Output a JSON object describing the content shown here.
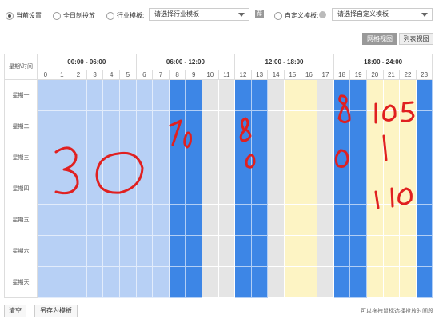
{
  "settings": {
    "radio_current": "当前设置",
    "radio_all_day": "全日制投放",
    "radio_industry": "行业模板:",
    "industry_select": "请选择行业模板",
    "filter_icon_text": "荐",
    "radio_custom": "自定义模板:",
    "custom_select": "请选择自定义模板"
  },
  "view": {
    "grid_label": "网格视图",
    "list_label": "列表视图"
  },
  "schedule": {
    "corner_label": "星期\\时间",
    "periods": [
      "00:00 - 06:00",
      "06:00 - 12:00",
      "12:00 - 18:00",
      "18:00 - 24:00"
    ],
    "hours": [
      "0",
      "1",
      "2",
      "3",
      "4",
      "5",
      "6",
      "7",
      "8",
      "9",
      "10",
      "11",
      "12",
      "13",
      "14",
      "15",
      "16",
      "17",
      "18",
      "19",
      "20",
      "21",
      "22",
      "23"
    ],
    "days": [
      "星期一",
      "星期二",
      "星期三",
      "星期四",
      "星期五",
      "星期六",
      "星期天"
    ],
    "hour_states": [
      "light",
      "light",
      "light",
      "light",
      "light",
      "light",
      "light",
      "light",
      "blue",
      "blue",
      "gray",
      "gray",
      "blue",
      "blue",
      "gray",
      "yellow",
      "yellow",
      "gray",
      "blue",
      "blue",
      "yellow",
      "yellow",
      "yellow",
      "blue"
    ],
    "colors": {
      "light": "#b7d0f5",
      "blue": "#3d86e6",
      "gray": "#e5e5e5",
      "yellow": "#fdf4c4"
    }
  },
  "handwritten_notes": [
    "30",
    "70",
    "80",
    "80",
    "105",
    "1",
    "110"
  ],
  "footer": {
    "clear_label": "清空",
    "save_template_label": "另存为模板",
    "hint": "可以拖拽鼠标选择投放时间段"
  }
}
